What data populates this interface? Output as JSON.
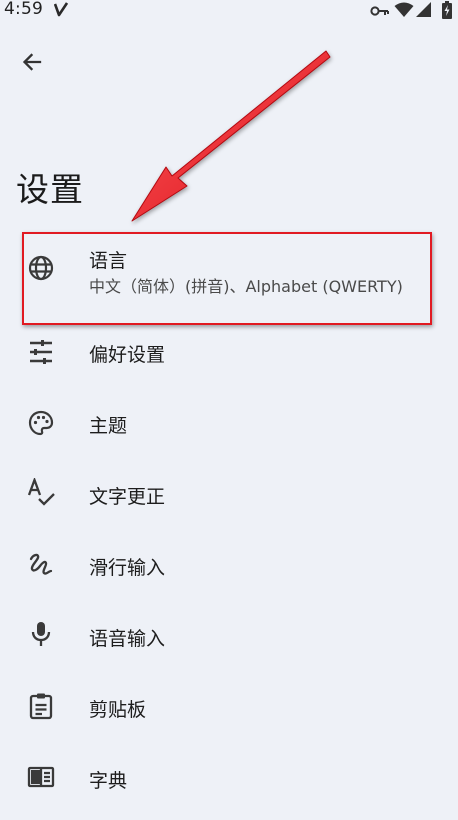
{
  "status_bar": {
    "time": "4:59",
    "icons": [
      "app-notification-icon",
      "vpn-key-icon",
      "wifi-icon",
      "cell-signal-icon",
      "battery-charging-icon"
    ]
  },
  "header": {
    "back_icon": "arrow-back-icon",
    "title": "设置"
  },
  "settings": {
    "items": [
      {
        "icon": "globe-icon",
        "label": "语言",
        "sublabel": "中文（简体）(拼音)、Alphabet (QWERTY)"
      },
      {
        "icon": "tune-icon",
        "label": "偏好设置"
      },
      {
        "icon": "palette-icon",
        "label": "主题"
      },
      {
        "icon": "spellcheck-icon",
        "label": "文字更正"
      },
      {
        "icon": "gesture-icon",
        "label": "滑行输入"
      },
      {
        "icon": "microphone-icon",
        "label": "语音输入"
      },
      {
        "icon": "clipboard-icon",
        "label": "剪贴板"
      },
      {
        "icon": "dictionary-book-icon",
        "label": "字典"
      }
    ]
  },
  "annotation": {
    "highlight_color": "#e11a22",
    "arrow_color": "#e11a22"
  }
}
